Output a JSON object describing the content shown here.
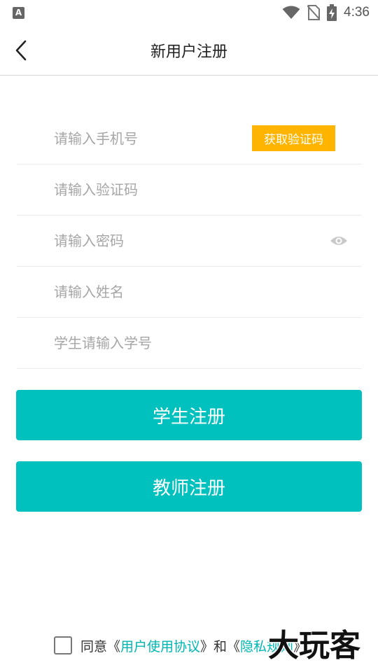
{
  "status_bar": {
    "app_icon_letter": "A",
    "time": "4:36"
  },
  "header": {
    "title": "新用户注册"
  },
  "form": {
    "phone_placeholder": "请输入手机号",
    "get_code_label": "获取验证码",
    "code_placeholder": "请输入验证码",
    "password_placeholder": "请输入密码",
    "name_placeholder": "请输入姓名",
    "student_id_placeholder": "学生请输入学号"
  },
  "buttons": {
    "student_register": "学生注册",
    "teacher_register": "教师注册"
  },
  "agreement": {
    "prefix": "同意《",
    "user_agreement": "用户使用协议",
    "middle": "》和《",
    "privacy_policy": "隐私规则",
    "suffix": "》"
  },
  "watermark_text": "大玩客",
  "colors": {
    "accent": "#00c1bd",
    "code_button": "#ffb400",
    "link": "#00b6b2"
  }
}
